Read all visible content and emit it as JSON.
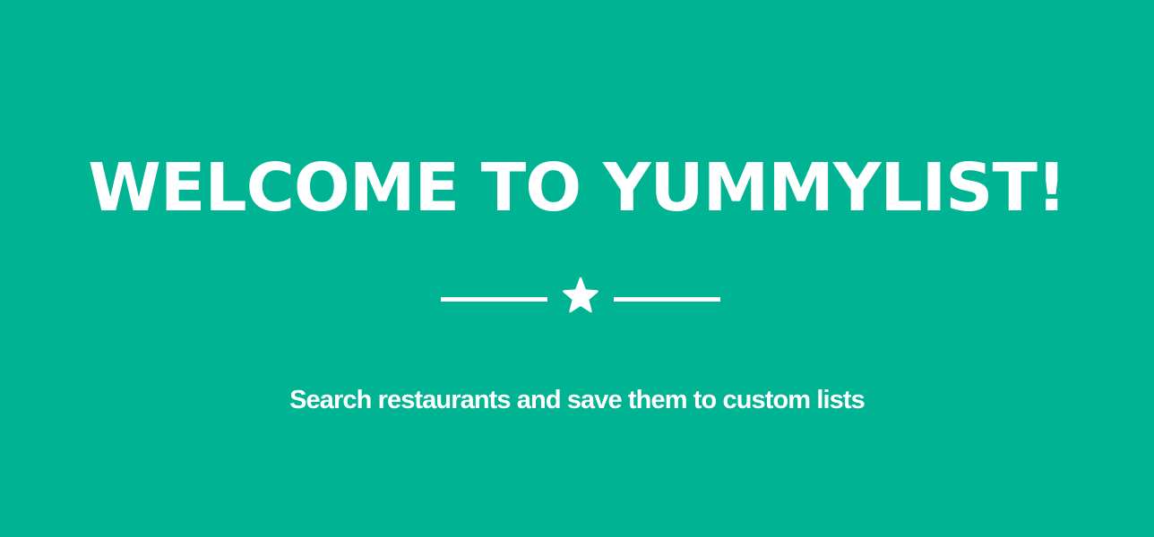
{
  "hero": {
    "title": "WELCOME TO YUMMYLIST!",
    "divider_icon": "star-icon",
    "subtitle": "Search restaurants and save them to custom lists"
  },
  "colors": {
    "background": "#00b493",
    "text": "#ffffff"
  }
}
